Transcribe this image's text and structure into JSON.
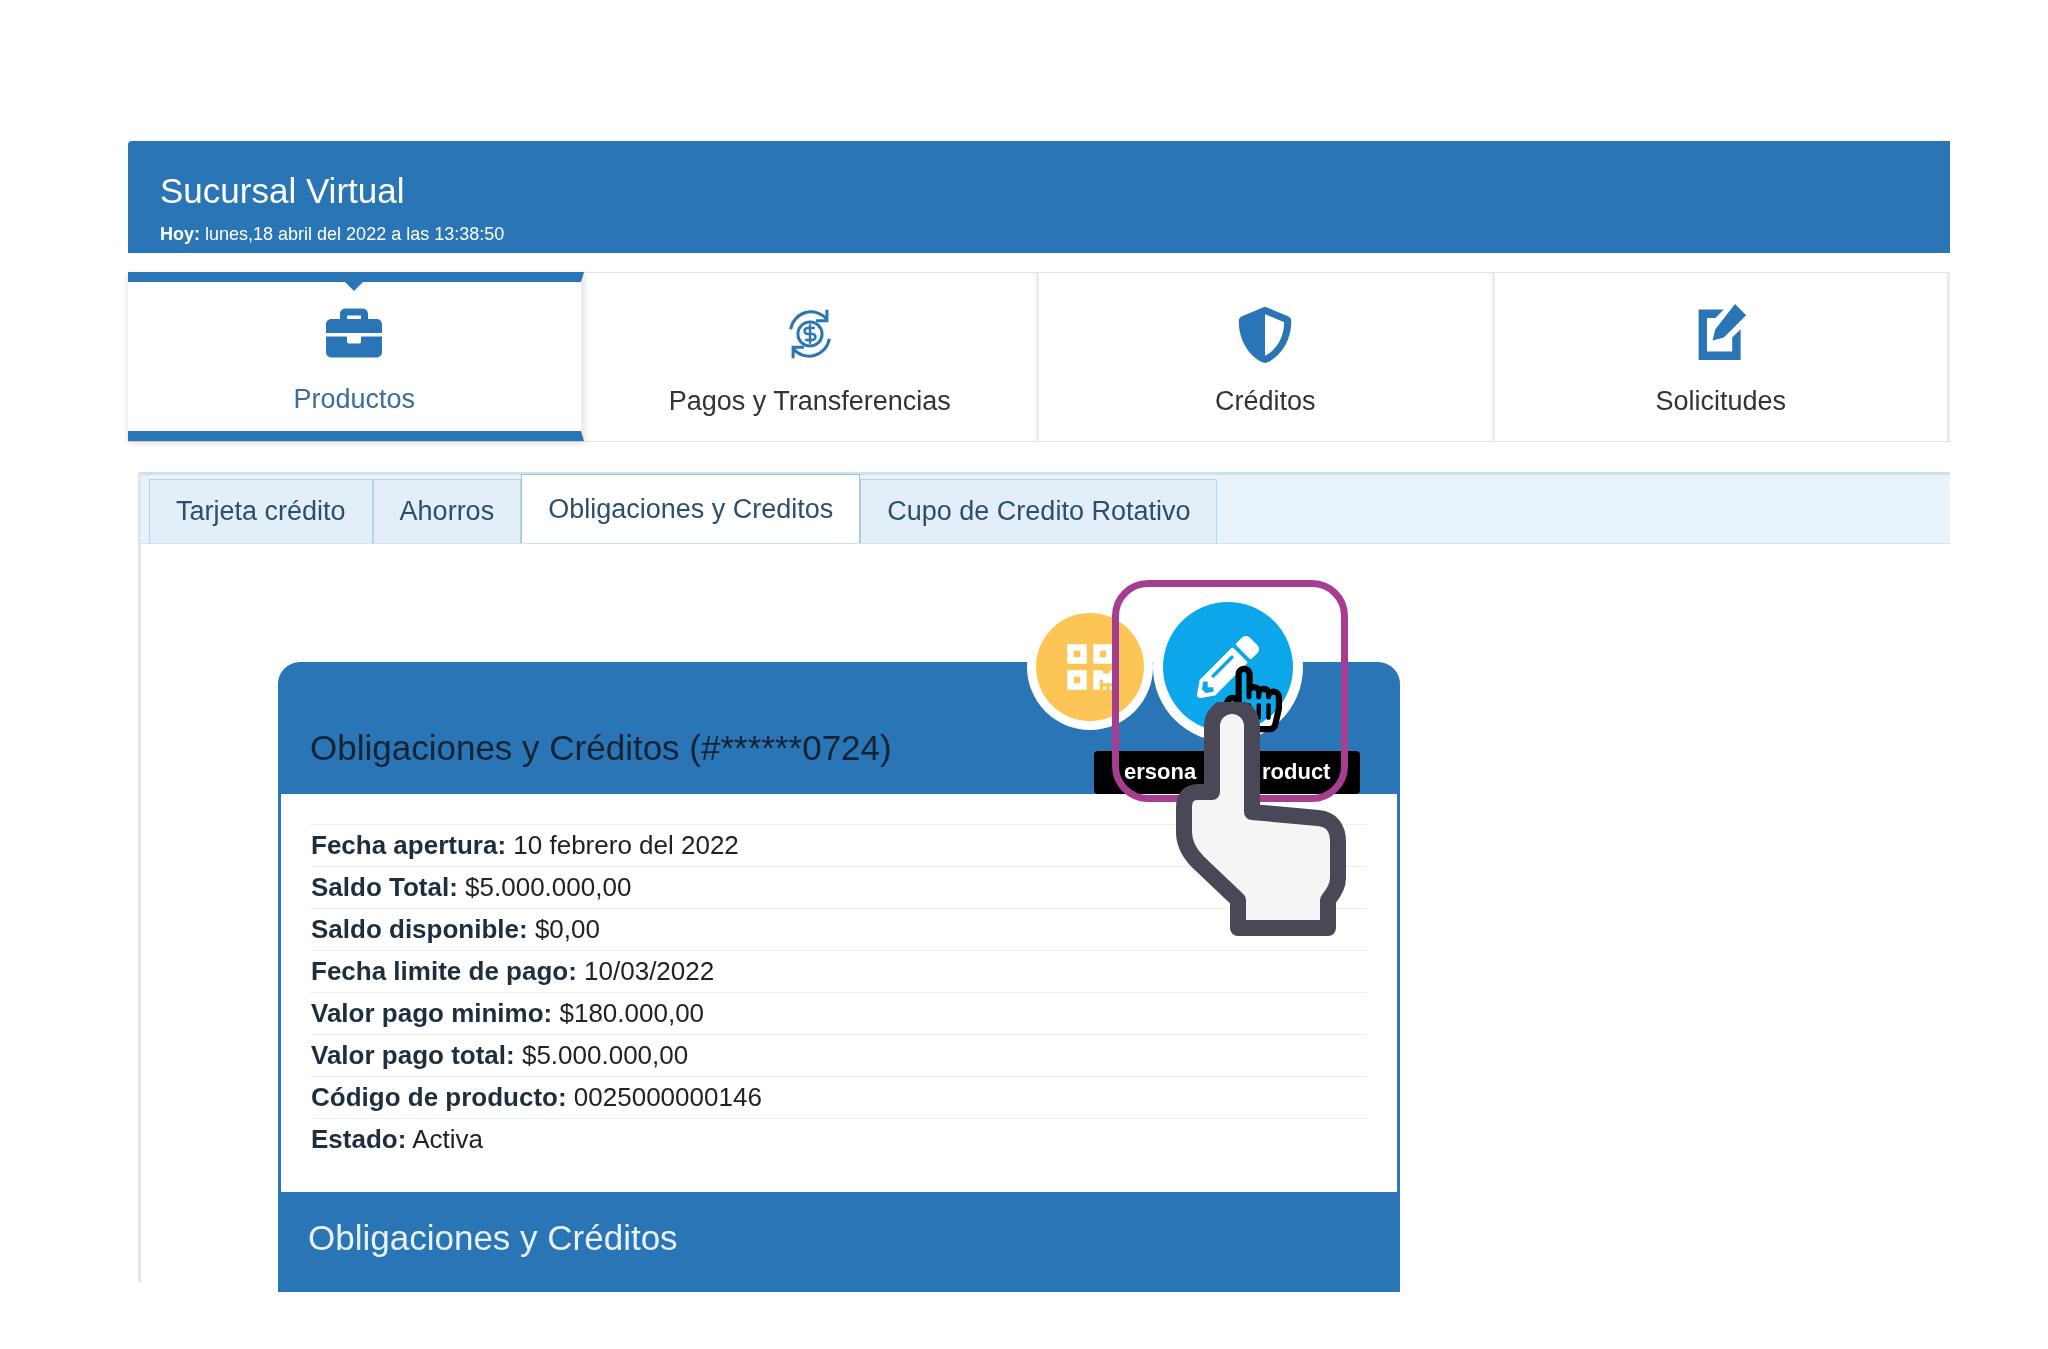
{
  "header": {
    "title": "Sucursal Virtual",
    "date_label": "Hoy:",
    "date_value": "lunes,18 abril del 2022 a las 13:38:50"
  },
  "nav": [
    {
      "label": "Productos",
      "selected": true
    },
    {
      "label": "Pagos y Transferencias",
      "selected": false
    },
    {
      "label": "Créditos",
      "selected": false
    },
    {
      "label": "Solicitudes",
      "selected": false
    }
  ],
  "subtabs": [
    {
      "label": "Tarjeta crédito",
      "selected": false
    },
    {
      "label": "Ahorros",
      "selected": false
    },
    {
      "label": "Obligaciones y Creditos",
      "selected": true
    },
    {
      "label": "Cupo de Credito Rotativo",
      "selected": false
    }
  ],
  "card": {
    "title": "Obligaciones y Créditos (#******0724)",
    "actions": [
      {
        "kind": "qr"
      },
      {
        "kind": "edit"
      }
    ],
    "tooltip": [
      "ersona",
      "roduct"
    ],
    "rows": [
      {
        "label": "Fecha apertura:",
        "value": "10 febrero del 2022"
      },
      {
        "label": "Saldo Total:",
        "value": "$5.000.000,00"
      },
      {
        "label": "Saldo disponible:",
        "value": "$0,00"
      },
      {
        "label": "Fecha limite de pago:",
        "value": "10/03/2022"
      },
      {
        "label": "Valor pago minimo:",
        "value": "$180.000,00"
      },
      {
        "label": "Valor pago total:",
        "value": "$5.000.000,00"
      },
      {
        "label": "Código de producto:",
        "value": "0025000000146"
      },
      {
        "label": "Estado:",
        "value": "Activa"
      }
    ],
    "footer_title": "Obligaciones y Créditos"
  }
}
